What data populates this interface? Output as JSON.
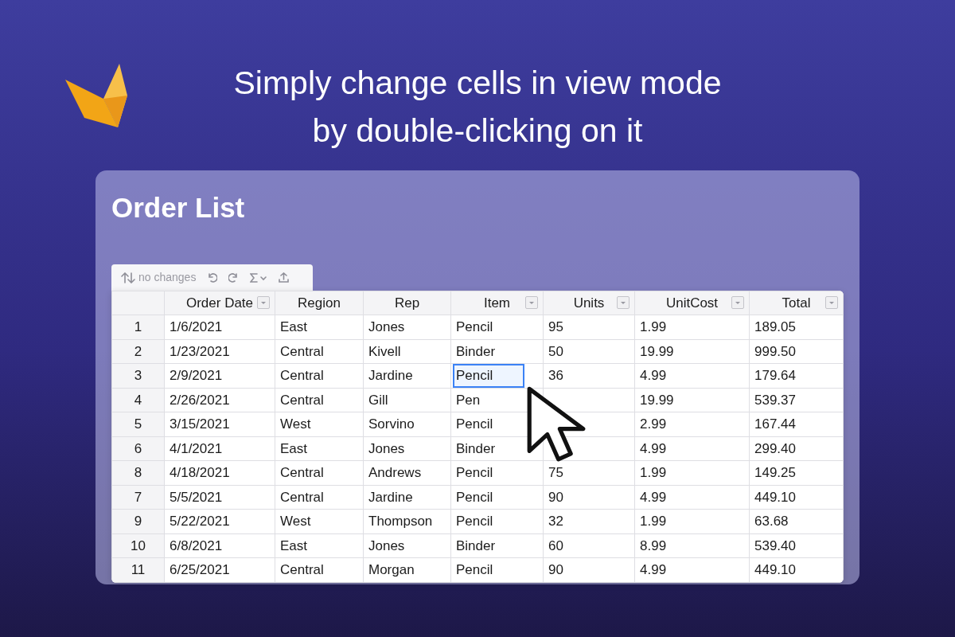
{
  "headline": [
    "Simply change cells in view mode",
    "by double-clicking on it"
  ],
  "panel": {
    "title": "Order List"
  },
  "toolbar": {
    "status": "no changes"
  },
  "table": {
    "columns": [
      {
        "label": "Order Date",
        "filter": true
      },
      {
        "label": "Region",
        "filter": false
      },
      {
        "label": "Rep",
        "filter": false
      },
      {
        "label": "Item",
        "filter": true
      },
      {
        "label": "Units",
        "filter": true
      },
      {
        "label": "UnitCost",
        "filter": true
      },
      {
        "label": "Total",
        "filter": true
      }
    ],
    "rows": [
      {
        "number": "1",
        "cells": [
          "1/6/2021",
          "East",
          "Jones",
          "Pencil",
          "95",
          "1.99",
          "189.05"
        ],
        "item_selected": false
      },
      {
        "number": "2",
        "cells": [
          "1/23/2021",
          "Central",
          "Kivell",
          "Binder",
          "50",
          "19.99",
          "999.50"
        ],
        "item_selected": false
      },
      {
        "number": "3",
        "cells": [
          "2/9/2021",
          "Central",
          "Jardine",
          "Pencil",
          "36",
          "4.99",
          "179.64"
        ],
        "item_selected": true
      },
      {
        "number": "4",
        "cells": [
          "2/26/2021",
          "Central",
          "Gill",
          "Pen",
          null,
          "19.99",
          "539.37"
        ],
        "item_selected": false
      },
      {
        "number": "5",
        "cells": [
          "3/15/2021",
          "West",
          "Sorvino",
          "Pencil",
          null,
          "2.99",
          "167.44"
        ],
        "item_selected": false
      },
      {
        "number": "6",
        "cells": [
          "4/1/2021",
          "East",
          "Jones",
          "Binder",
          null,
          "4.99",
          "299.40"
        ],
        "item_selected": false
      },
      {
        "number": "8",
        "cells": [
          "4/18/2021",
          "Central",
          "Andrews",
          "Pencil",
          "75",
          "1.99",
          "149.25"
        ],
        "item_selected": false
      },
      {
        "number": "7",
        "cells": [
          "5/5/2021",
          "Central",
          "Jardine",
          "Pencil",
          "90",
          "4.99",
          "449.10"
        ],
        "item_selected": false
      },
      {
        "number": "9",
        "cells": [
          "5/22/2021",
          "West",
          "Thompson",
          "Pencil",
          "32",
          "1.99",
          "63.68"
        ],
        "item_selected": false
      },
      {
        "number": "10",
        "cells": [
          "6/8/2021",
          "East",
          "Jones",
          "Binder",
          "60",
          "8.99",
          "539.40"
        ],
        "item_selected": false
      },
      {
        "number": "11",
        "cells": [
          "6/25/2021",
          "Central",
          "Morgan",
          "Pencil",
          "90",
          "4.99",
          "449.10"
        ],
        "item_selected": false
      }
    ]
  }
}
